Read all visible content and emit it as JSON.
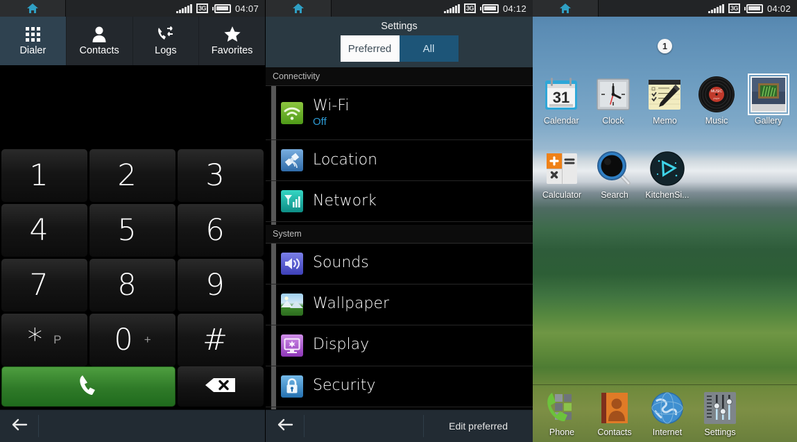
{
  "screens": [
    {
      "id": "dialer",
      "statusbar": {
        "home_icon": "home-icon",
        "signal_icon": "signal-bars-icon",
        "network": "3G",
        "battery_icon": "battery-icon",
        "time": "04:07"
      },
      "tabs": [
        {
          "label": "Dialer",
          "icon": "app-grid-icon",
          "active": true
        },
        {
          "label": "Contacts",
          "icon": "person-icon",
          "active": false
        },
        {
          "label": "Logs",
          "icon": "call-log-icon",
          "active": false
        },
        {
          "label": "Favorites",
          "icon": "star-icon",
          "active": false
        }
      ],
      "number_display": "",
      "keypad": [
        {
          "main": "1",
          "sub": ""
        },
        {
          "main": "2",
          "sub": ""
        },
        {
          "main": "3",
          "sub": ""
        },
        {
          "main": "4",
          "sub": ""
        },
        {
          "main": "5",
          "sub": ""
        },
        {
          "main": "6",
          "sub": ""
        },
        {
          "main": "7",
          "sub": ""
        },
        {
          "main": "8",
          "sub": ""
        },
        {
          "main": "9",
          "sub": ""
        },
        {
          "main": "*",
          "sub": "P"
        },
        {
          "main": "0",
          "sub": "+"
        },
        {
          "main": "#",
          "sub": ""
        }
      ],
      "call_button": {
        "icon": "phone-handset-icon",
        "color": "#2f7a28"
      },
      "delete_button": {
        "icon": "backspace-icon"
      },
      "navbar": {
        "back_icon": "back-arrow-icon",
        "label": ""
      }
    },
    {
      "id": "settings",
      "statusbar": {
        "home_icon": "home-icon",
        "signal_icon": "signal-bars-icon",
        "network": "3G",
        "battery_icon": "battery-icon",
        "time": "04:12"
      },
      "title": "Settings",
      "segmented": {
        "options": [
          "Preferred",
          "All"
        ],
        "selected": "Preferred"
      },
      "sections": [
        {
          "heading": "Connectivity",
          "rows": [
            {
              "label": "Wi-Fi",
              "sub": "Off",
              "icon": "wifi-icon",
              "icon_color": "#6ab023"
            },
            {
              "label": "Location",
              "sub": "",
              "icon": "satellite-icon",
              "icon_color": "#4a86c8"
            },
            {
              "label": "Network",
              "sub": "",
              "icon": "network-signal-icon",
              "icon_color": "#16a79a"
            }
          ]
        },
        {
          "heading": "System",
          "rows": [
            {
              "label": "Sounds",
              "sub": "",
              "icon": "speaker-icon",
              "icon_color": "#5b5fd0"
            },
            {
              "label": "Wallpaper",
              "sub": "",
              "icon": "landscape-icon",
              "icon_color": "#3e7fbe"
            },
            {
              "label": "Display",
              "sub": "",
              "icon": "monitor-icon",
              "icon_color": "#b05bd0"
            },
            {
              "label": "Security",
              "sub": "",
              "icon": "lock-icon",
              "icon_color": "#3e8fd0"
            }
          ]
        }
      ],
      "navbar": {
        "back_icon": "back-arrow-icon",
        "label": "Edit preferred"
      }
    },
    {
      "id": "home",
      "statusbar": {
        "home_icon": "home-icon",
        "signal_icon": "signal-bars-icon",
        "network": "3G",
        "battery_icon": "battery-icon",
        "time": "04:02"
      },
      "page_indicator": "1",
      "app_rows": [
        [
          {
            "label": "Calendar",
            "icon": "calendar-icon",
            "date": "31",
            "selected": false
          },
          {
            "label": "Clock",
            "icon": "analog-clock-icon",
            "selected": false
          },
          {
            "label": "Memo",
            "icon": "memo-notepad-icon",
            "selected": false
          },
          {
            "label": "Music",
            "icon": "vinyl-record-icon",
            "selected": false
          },
          {
            "label": "Gallery",
            "icon": "photo-frame-icon",
            "selected": true
          }
        ],
        [
          {
            "label": "Calculator",
            "icon": "calculator-icon",
            "selected": false
          },
          {
            "label": "Search",
            "icon": "magnifier-icon",
            "selected": false
          },
          {
            "label": "KitchenSi...",
            "icon": "kitchensink-icon",
            "selected": false
          }
        ]
      ],
      "dock": [
        {
          "label": "Phone",
          "icon": "phone-keypad-icon"
        },
        {
          "label": "Contacts",
          "icon": "contacts-book-icon"
        },
        {
          "label": "Internet",
          "icon": "globe-icon"
        },
        {
          "label": "Settings",
          "icon": "sliders-icon"
        }
      ]
    }
  ],
  "colors": {
    "accent_blue": "#2e9bd4",
    "tab_active": "#2f4250",
    "navbar_bg": "#222b33",
    "call_green": "#2f7a28",
    "seg_selected_bg": "#fbfbfb",
    "seg_unselected_bg": "#1d5578"
  }
}
